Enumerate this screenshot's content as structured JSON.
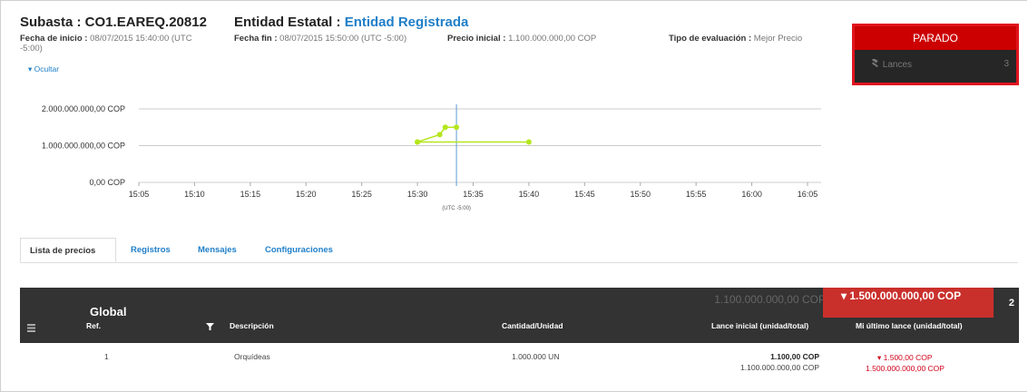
{
  "header": {
    "title": "Subasta : CO1.EAREQ.20812",
    "entity_label": "Entidad Estatal : ",
    "entity_value": "Entidad Registrada",
    "start_label": "Fecha de inicio : ",
    "start_value": "08/07/2015 15:40:00 (UTC",
    "start_value_cont": "-5:00)",
    "end_label": "Fecha fin : ",
    "end_value": "08/07/2015 15:50:00 (UTC -5:00)",
    "price_label": "Precio inicial : ",
    "price_value": "1.100.000.000,00 COP",
    "eval_label": "Tipo de evaluación : ",
    "eval_value": "Mejor Precio",
    "hide_link": "▾ Ocultar"
  },
  "status": {
    "state": "PARADO",
    "bids_label": "Lances",
    "bids_count": "3",
    "bids_icon": "gavel-icon"
  },
  "chart_data": {
    "type": "line",
    "y_ticks": [
      "2.000.000.000,00 COP",
      "1.000.000.000,00 COP",
      "0,00 COP"
    ],
    "y_values": [
      2000000000,
      1000000000,
      0
    ],
    "x_ticks": [
      "15:05",
      "15:10",
      "15:15",
      "15:20",
      "15:25",
      "15:30",
      "15:35",
      "15:40",
      "15:45",
      "15:50",
      "15:55",
      "16:00",
      "16:05"
    ],
    "x_note": "(UTC -5:00)",
    "ylim": [
      0,
      2000000000
    ],
    "series": [
      {
        "color": "#b5e61d",
        "points": [
          {
            "t": "15:30",
            "v": 1100000000
          },
          {
            "t": "15:32",
            "v": 1300000000
          },
          {
            "t": "15:32.5",
            "v": 1500000000
          },
          {
            "t": "15:33.5",
            "v": 1500000000
          }
        ]
      },
      {
        "color": "#b5e61d",
        "points": [
          {
            "t": "15:30",
            "v": 1100000000
          },
          {
            "t": "15:40",
            "v": 1100000000
          }
        ]
      }
    ],
    "now_marker": "15:33.5",
    "grid": true
  },
  "tabs": [
    {
      "label": "Lista de precios"
    },
    {
      "label": "Registros"
    },
    {
      "label": "Mensajes"
    },
    {
      "label": "Configuraciones"
    }
  ],
  "grid": {
    "group_label": "Global",
    "initial_total": "1.100.000.000,00 COP",
    "my_total": "▾ 1.500.000.000,00 COP",
    "rank": "2",
    "columns": {
      "ref": "Ref.",
      "desc": "Descripción",
      "qty": "Cantidad/Unidad",
      "initial": "Lance inicial (unidad/total)",
      "mine": "Mi último lance (unidad/total)"
    },
    "rows": [
      {
        "ref": "1",
        "desc": "Orquídeas",
        "qty": "1.000.000 UN",
        "initial_unit": "1.100,00 COP",
        "initial_total": "1.100.000.000,00 COP",
        "mine_unit": "▾ 1.500,00 COP",
        "mine_total": "1.500.000.000,00 COP"
      }
    ]
  }
}
